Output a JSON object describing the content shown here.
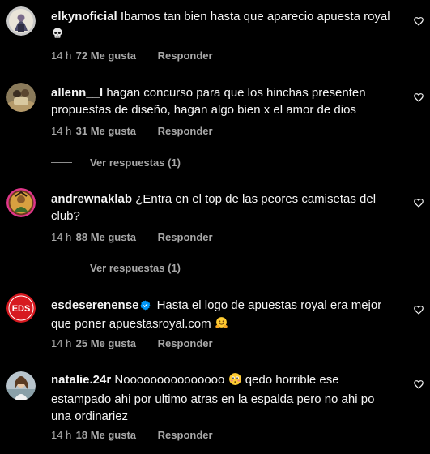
{
  "comments": [
    {
      "username": "elkynoficial",
      "text": "Ibamos tan bien hasta que aparecio apuesta royal",
      "emoji": "skull-emoji",
      "time": "14 h",
      "likes": "72 Me gusta",
      "reply": "Responder"
    },
    {
      "username": "allenn__l",
      "text": "hagan concurso para que los hinchas presenten propuestas de diseño, hagan algo bien x el amor de dios",
      "time": "14 h",
      "likes": "31 Me gusta",
      "reply": "Responder",
      "view_replies": "Ver respuestas (1)"
    },
    {
      "username": "andrewnaklab",
      "text": "¿Entra en el top de las peores camisetas del club?",
      "time": "14 h",
      "likes": "88 Me gusta",
      "reply": "Responder",
      "view_replies": "Ver respuestas (1)"
    },
    {
      "username": "esdeserenense",
      "verified": true,
      "text": "Hasta el logo de apuestas royal era mejor que poner apuestasroyal.com",
      "emoji": "hugging-face-emoji",
      "time": "14 h",
      "likes": "25 Me gusta",
      "reply": "Responder",
      "avatar_text": "EDS"
    },
    {
      "username": "natalie.24r",
      "text_before_emoji": "Nooooooooooooooo",
      "emoji": "flushed-face-emoji",
      "text": "qedo horrible ese estampado ahi por ultimo atras en la espalda pero no ahi po una ordinariez",
      "time": "14 h",
      "likes": "18 Me gusta",
      "reply": "Responder"
    }
  ],
  "colors": {
    "background": "#000000",
    "text": "#f5f5f5",
    "meta": "#a8a8a8",
    "verified": "#0095f6",
    "eds_red": "#d71920"
  },
  "icons": {
    "like": "heart-outline-icon",
    "verified": "verified-badge-icon"
  }
}
